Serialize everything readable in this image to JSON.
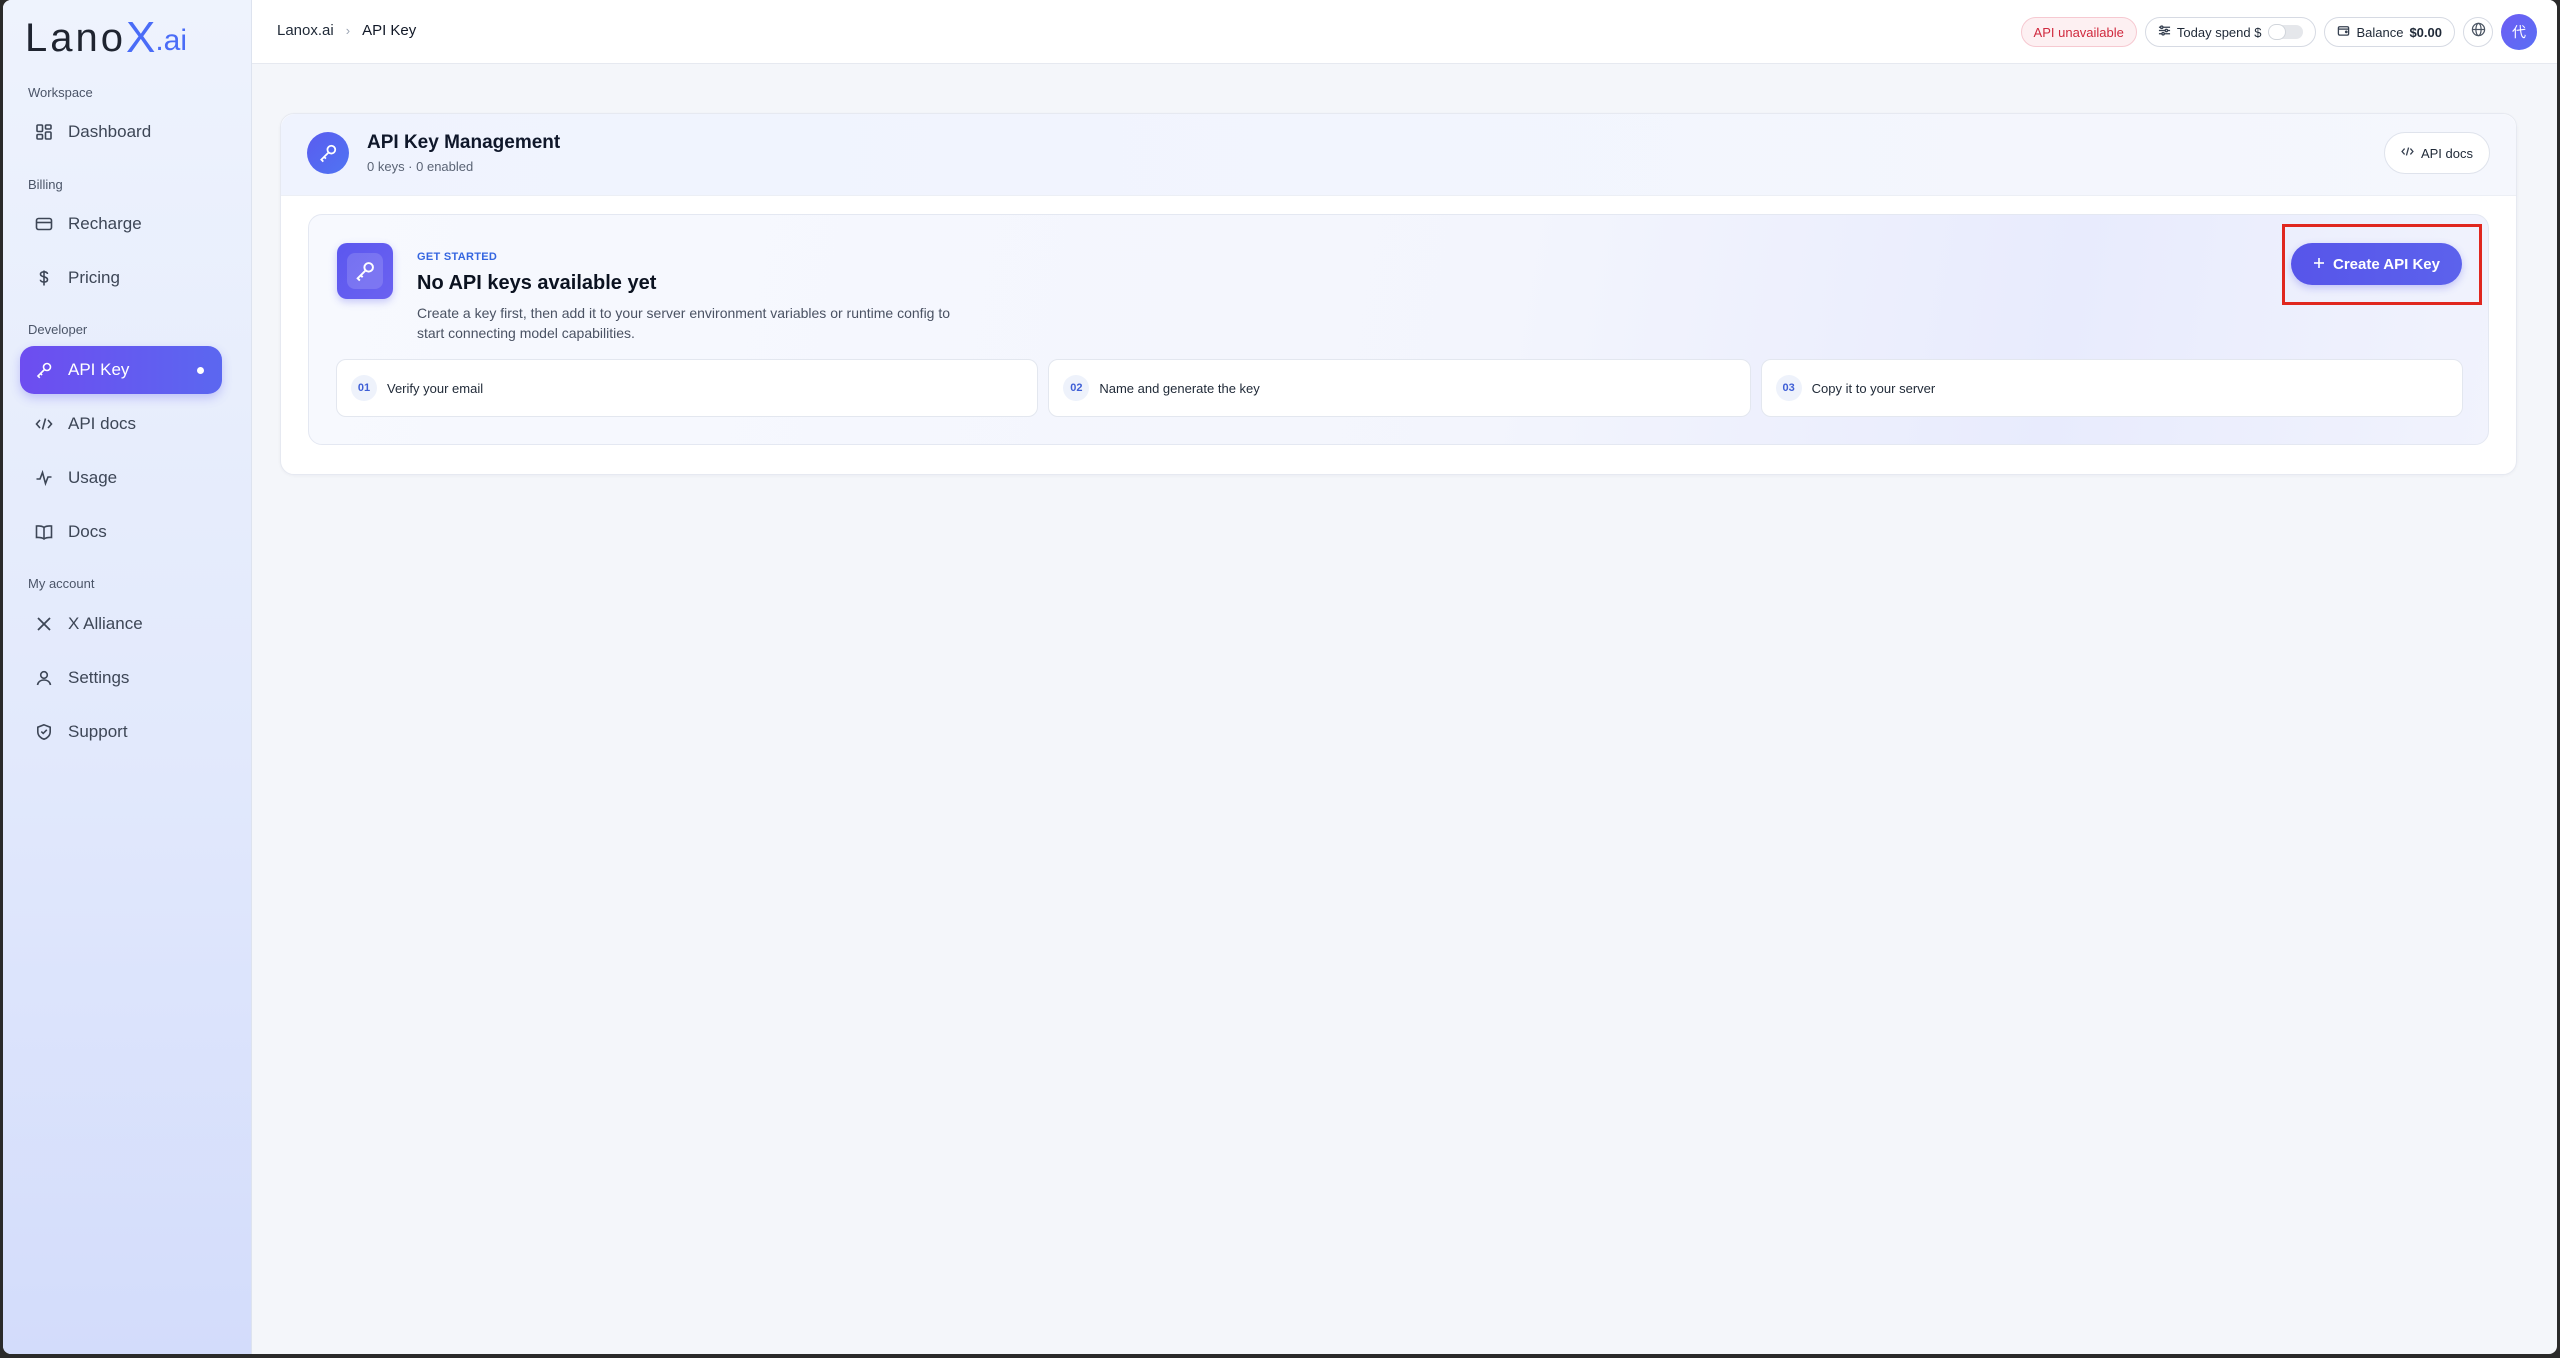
{
  "brand": {
    "name": "Lano",
    "x": "X",
    "suffix": ".ai"
  },
  "sidebar": {
    "sections": [
      {
        "label": "Workspace"
      },
      {
        "label": "Billing"
      },
      {
        "label": "Developer"
      },
      {
        "label": "My account"
      }
    ],
    "items": [
      {
        "label": "Dashboard",
        "icon": "grid-icon"
      },
      {
        "label": "Recharge",
        "icon": "card-icon"
      },
      {
        "label": "Pricing",
        "icon": "dollar-icon"
      },
      {
        "label": "API Key",
        "icon": "key-icon",
        "active": true
      },
      {
        "label": "API docs",
        "icon": "code-icon"
      },
      {
        "label": "Usage",
        "icon": "activity-icon"
      },
      {
        "label": "Docs",
        "icon": "book-icon"
      },
      {
        "label": "X Alliance",
        "icon": "x-icon"
      },
      {
        "label": "Settings",
        "icon": "user-icon"
      },
      {
        "label": "Support",
        "icon": "shield-icon"
      }
    ]
  },
  "breadcrumb": {
    "root": "Lanox.ai",
    "separator": "›",
    "current": "API Key"
  },
  "topbar": {
    "status": "API unavailable",
    "today_spend": "Today spend $",
    "balance_label": "Balance",
    "balance_value": "$0.00",
    "avatar": "代"
  },
  "card": {
    "title": "API Key Management",
    "subtitle": "0 keys · 0 enabled",
    "docs_button": "API docs",
    "eyebrow": "GET STARTED",
    "empty_title": "No API keys available yet",
    "empty_desc": "Create a key first, then add it to your server environment variables or runtime config to start connecting model capabilities.",
    "create_button": "Create API Key",
    "steps": [
      {
        "num": "01",
        "label": "Verify your email"
      },
      {
        "num": "02",
        "label": "Name and generate the key"
      },
      {
        "num": "03",
        "label": "Copy it to your server"
      }
    ]
  },
  "colors": {
    "accent": "#5755ea",
    "error": "#d0293e",
    "highlight": "#e0271f"
  }
}
